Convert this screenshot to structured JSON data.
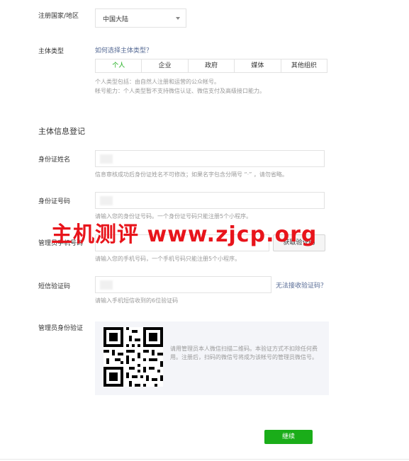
{
  "form": {
    "region": {
      "label": "注册国家/地区",
      "value": "中国大陆"
    },
    "entity_type": {
      "label": "主体类型",
      "help_link": "如何选择主体类型？",
      "options": [
        "个人",
        "企业",
        "政府",
        "媒体",
        "其他组织"
      ],
      "selected": "个人",
      "desc_line1": "个人类型包括：由自然人注册和运营的公众帐号。",
      "desc_line2": "帐号能力：个人类型暂不支持微信认证、微信支付及高级接口能力。"
    },
    "section_title": "主体信息登记",
    "id_name": {
      "label": "身份证姓名",
      "hint": "信息审核成功后身份证姓名不可修改；如果名字包含分隔号 “·” ，请勿省略。"
    },
    "id_number": {
      "label": "身份证号码",
      "hint_visible": "请输入您的身份证号码。一个身份证号码只能注册5个小程序。"
    },
    "phone": {
      "label": "管理员手机号码",
      "sms_button": "获取验证码",
      "hint": "请输入您的手机号码，一个手机号码只能注册5个小程序。"
    },
    "sms_code": {
      "label": "短信验证码",
      "no_code_link": "无法接收验证码？",
      "hint": "请输入手机短信收到的6位验证码"
    },
    "admin_verify": {
      "label": "管理员身份验证",
      "qr_text": "请用管理员本人微信扫描二维码。本验证方式不扣除任何费用。注册后，扫码的微信号将成为该帐号的管理员微信号。"
    },
    "continue_button": "继续"
  },
  "watermark": "主机测评  www.zjcp.org",
  "colors": {
    "accent": "#1aad19",
    "link": "#576b95",
    "watermark": "#e8141b"
  }
}
